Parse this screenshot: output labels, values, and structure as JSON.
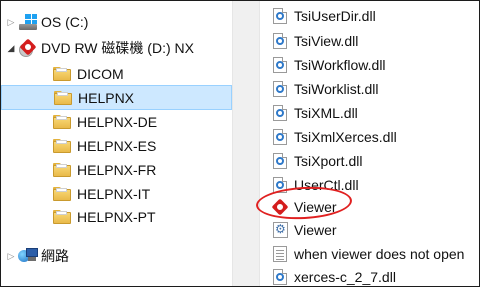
{
  "nav": {
    "items": [
      {
        "label": "OS (C:)",
        "icon": "os-drive-icon"
      },
      {
        "label": "DVD RW 磁碟機 (D:) NX",
        "icon": "dvd-drive-icon"
      },
      {
        "label": "DICOM",
        "icon": "folder-icon"
      },
      {
        "label": "HELPNX",
        "icon": "folder-icon"
      },
      {
        "label": "HELPNX-DE",
        "icon": "folder-icon"
      },
      {
        "label": "HELPNX-ES",
        "icon": "folder-icon"
      },
      {
        "label": "HELPNX-FR",
        "icon": "folder-icon"
      },
      {
        "label": "HELPNX-IT",
        "icon": "folder-icon"
      },
      {
        "label": "HELPNX-PT",
        "icon": "folder-icon"
      },
      {
        "label": "網路",
        "icon": "network-icon"
      }
    ],
    "selected": "HELPNX"
  },
  "files": [
    {
      "label": "TsiUserDir.dll",
      "icon": "dll-icon"
    },
    {
      "label": "TsiView.dll",
      "icon": "dll-icon"
    },
    {
      "label": "TsiWorkflow.dll",
      "icon": "dll-icon"
    },
    {
      "label": "TsiWorklist.dll",
      "icon": "dll-icon"
    },
    {
      "label": "TsiXML.dll",
      "icon": "dll-icon"
    },
    {
      "label": "TsiXmlXerces.dll",
      "icon": "dll-icon"
    },
    {
      "label": "TsiXport.dll",
      "icon": "dll-icon"
    },
    {
      "label": "UserCtl.dll",
      "icon": "dll-icon"
    },
    {
      "label": "Viewer",
      "icon": "viewer-app-icon"
    },
    {
      "label": "Viewer",
      "icon": "config-file-icon"
    },
    {
      "label": "when viewer does not open",
      "icon": "text-file-icon"
    },
    {
      "label": "xerces-c_2_7.dll",
      "icon": "dll-icon"
    }
  ],
  "colors": {
    "selection_bg": "#cde8ff",
    "selection_border": "#99d1ff",
    "annotation": "#e02020",
    "brand_red": "#d41d1d"
  }
}
